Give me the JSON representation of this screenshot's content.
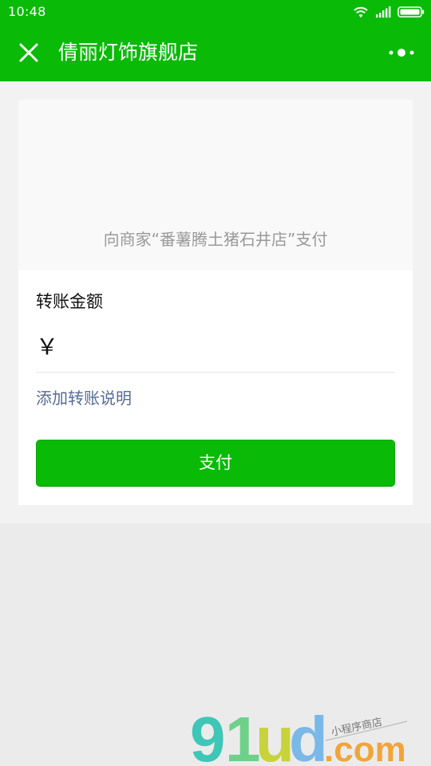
{
  "status_bar": {
    "time": "10:48",
    "icons": [
      "wifi-icon",
      "signal-icon",
      "battery-icon"
    ]
  },
  "nav": {
    "title": "倩丽灯饰旗舰店",
    "close_icon": "close-icon",
    "more_icon": "more-dots-icon"
  },
  "merchant": {
    "text": "向商家“番薯腾土猪石井店”支付"
  },
  "form": {
    "amount_label": "转账金额",
    "currency_symbol": "￥",
    "amount_value": "",
    "add_note_label": "添加转账说明"
  },
  "pay_button": {
    "label": "支付"
  },
  "watermark": {
    "brand": "91ud",
    "tld": ".com",
    "tagline": "小程序商店"
  },
  "colors": {
    "brand_green": "#09bb07",
    "link_blue": "#576b95",
    "background": "#ebebeb",
    "merchant_text": "#999999"
  }
}
